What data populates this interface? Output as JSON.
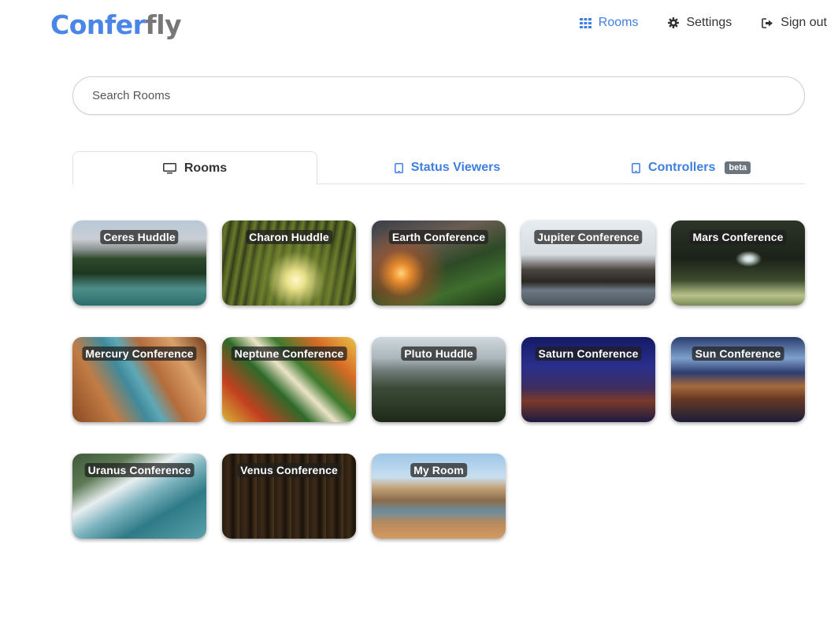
{
  "brand": {
    "part1": "Confer",
    "part2": "fly"
  },
  "nav": {
    "rooms": "Rooms",
    "settings": "Settings",
    "sign_out": "Sign out"
  },
  "search": {
    "placeholder": "Search Rooms"
  },
  "tabs": [
    {
      "label": "Rooms",
      "icon": "monitor-icon",
      "active": true
    },
    {
      "label": "Status Viewers",
      "icon": "tablet-icon",
      "active": false
    },
    {
      "label": "Controllers",
      "icon": "tablet-icon",
      "active": false,
      "badge": "beta"
    }
  ],
  "rooms": [
    {
      "name": "Ceres Huddle"
    },
    {
      "name": "Charon Huddle"
    },
    {
      "name": "Earth Conference"
    },
    {
      "name": "Jupiter Conference"
    },
    {
      "name": "Mars Conference"
    },
    {
      "name": "Mercury Conference"
    },
    {
      "name": "Neptune Conference"
    },
    {
      "name": "Pluto Huddle"
    },
    {
      "name": "Saturn Conference"
    },
    {
      "name": "Sun Conference"
    },
    {
      "name": "Uranus Conference"
    },
    {
      "name": "Venus Conference"
    },
    {
      "name": "My Room"
    }
  ],
  "colors": {
    "accent": "#3f7fe0",
    "text": "#333333",
    "badge": "#6c757d"
  }
}
